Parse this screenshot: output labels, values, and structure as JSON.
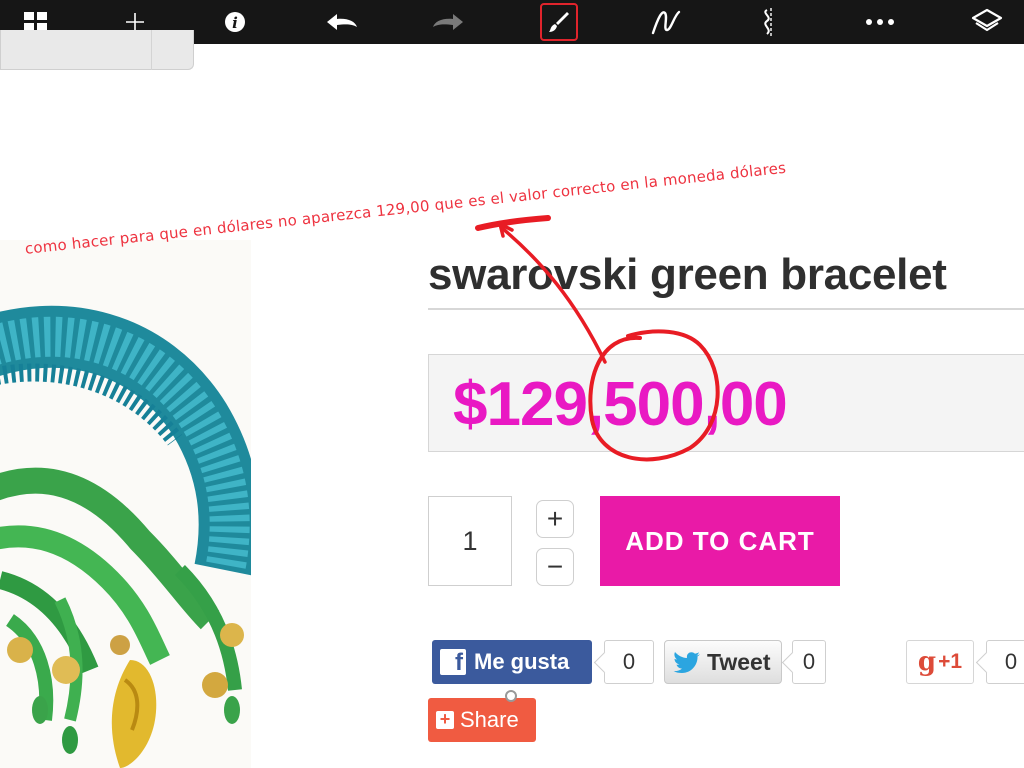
{
  "toolbar": {
    "buttons": [
      {
        "name": "grid-view-button",
        "icon": "grid-icon"
      },
      {
        "name": "add-button",
        "icon": "plus-icon"
      },
      {
        "name": "info-button",
        "icon": "info-icon"
      },
      {
        "name": "undo-button",
        "icon": "undo-arrow-icon"
      },
      {
        "name": "redo-button",
        "icon": "redo-arrow-icon",
        "disabled": true
      },
      {
        "name": "brush-tool-button",
        "icon": "brush-icon",
        "active": true
      },
      {
        "name": "pen-tool-button",
        "icon": "pen-stroke-icon"
      },
      {
        "name": "split-view-button",
        "icon": "split-icon"
      },
      {
        "name": "more-button",
        "icon": "ellipsis-icon"
      },
      {
        "name": "layers-button",
        "icon": "layers-icon"
      }
    ],
    "active_color": "#e0242c"
  },
  "annotation": {
    "text": "como hacer para que en dólares no aparezca 129,00 que es el valor correcto en la moneda dólares",
    "color": "#ee3340"
  },
  "product": {
    "title": "swarovski green bracelet",
    "price": "$129,500,00",
    "price_color": "#e919c3",
    "quantity": "1",
    "stepper_plus": "+",
    "stepper_minus": "−",
    "add_to_cart": "ADD TO CART",
    "cart_color": "#e91aa7"
  },
  "social": {
    "fb_label": "Me gusta",
    "fb_count": "0",
    "tweet_label": "Tweet",
    "tweet_count": "0",
    "gplus_label": "+1",
    "gplus_count": "0",
    "share_label": "Share"
  }
}
